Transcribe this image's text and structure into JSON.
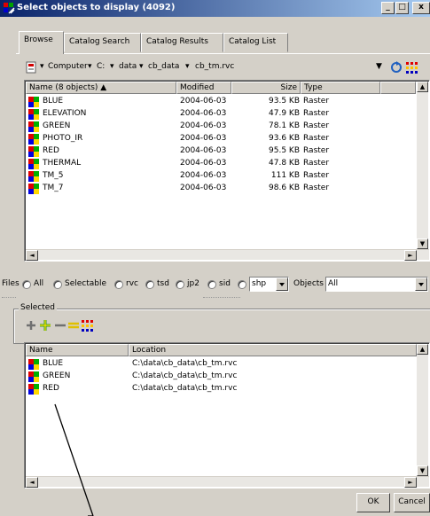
{
  "window": {
    "title": "Select objects to display (4092)",
    "controls": {
      "minimize": "_",
      "maximize": "□",
      "close": "x"
    }
  },
  "tabs": [
    {
      "label": "Browse",
      "active": true
    },
    {
      "label": "Catalog Search",
      "active": false
    },
    {
      "label": "Catalog Results",
      "active": false
    },
    {
      "label": "Catalog List",
      "active": false
    }
  ],
  "path": {
    "segments": [
      "Computer",
      "C:",
      "data",
      "cb_data",
      "cb_tm.rvc"
    ]
  },
  "file_list": {
    "columns": [
      "Name (8 objects) ▲",
      "Modified",
      "Size",
      "Type"
    ],
    "rows": [
      {
        "name": "BLUE",
        "modified": "2004-06-03",
        "size": "93.5 KB",
        "type": "Raster"
      },
      {
        "name": "ELEVATION",
        "modified": "2004-06-03",
        "size": "47.9 KB",
        "type": "Raster"
      },
      {
        "name": "GREEN",
        "modified": "2004-06-03",
        "size": "78.1 KB",
        "type": "Raster"
      },
      {
        "name": "PHOTO_IR",
        "modified": "2004-06-03",
        "size": "93.6 KB",
        "type": "Raster"
      },
      {
        "name": "RED",
        "modified": "2004-06-03",
        "size": "95.5 KB",
        "type": "Raster"
      },
      {
        "name": "THERMAL",
        "modified": "2004-06-03",
        "size": "47.8 KB",
        "type": "Raster"
      },
      {
        "name": "TM_5",
        "modified": "2004-06-03",
        "size": "111 KB",
        "type": "Raster"
      },
      {
        "name": "TM_7",
        "modified": "2004-06-03",
        "size": "98.6 KB",
        "type": "Raster"
      }
    ]
  },
  "filters": {
    "files_label": "Files",
    "options": [
      "All",
      "Selectable",
      "rvc",
      "tsd",
      "jp2",
      "sid"
    ],
    "type_value": "shp",
    "objects_label": "Objects",
    "objects_value": "All"
  },
  "selected": {
    "group_label": "Selected",
    "columns": [
      "Name",
      "Location"
    ],
    "rows": [
      {
        "name": "BLUE",
        "location": "C:\\data\\cb_data\\cb_tm.rvc"
      },
      {
        "name": "GREEN",
        "location": "C:\\data\\cb_data\\cb_tm.rvc"
      },
      {
        "name": "RED",
        "location": "C:\\data\\cb_data\\cb_tm.rvc"
      }
    ]
  },
  "buttons": {
    "ok": "OK",
    "cancel": "Cancel"
  },
  "colors": {
    "title_start": "#0a246a",
    "title_end": "#a6caf0",
    "dialog_bg": "#d4d0c8"
  }
}
